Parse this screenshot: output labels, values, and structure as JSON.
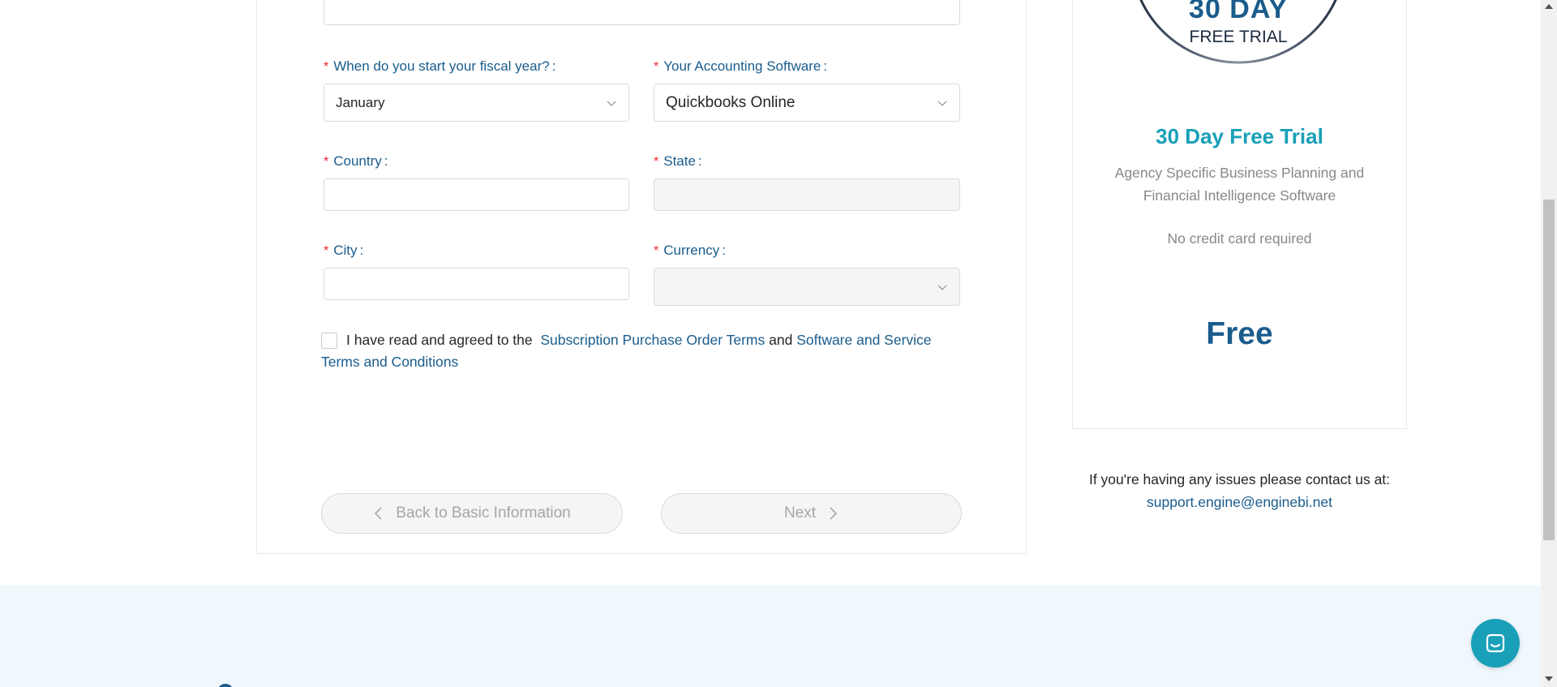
{
  "form": {
    "fiscal_year": {
      "label": "When do you start your fiscal year?",
      "required_mark": "*",
      "colon": ":",
      "value": "January"
    },
    "accounting_software": {
      "label": "Your Accounting Software",
      "required_mark": "*",
      "colon": ":",
      "value": "Quickbooks Online"
    },
    "country": {
      "label": "Country",
      "required_mark": "*",
      "colon": ":",
      "value": ""
    },
    "state": {
      "label": "State",
      "required_mark": "*",
      "colon": ":",
      "value": ""
    },
    "city": {
      "label": "City",
      "required_mark": "*",
      "colon": ":",
      "value": ""
    },
    "currency": {
      "label": "Currency",
      "required_mark": "*",
      "colon": ":",
      "value": ""
    },
    "agreement": {
      "checked": false,
      "prefix": "I have read and agreed to the",
      "link1": "Subscription Purchase Order Terms",
      "joiner": "and",
      "link2": "Software and Service Terms and Conditions"
    },
    "back_button": "Back to Basic Information",
    "next_button": "Next"
  },
  "trial_panel": {
    "badge_days": "30 DAY",
    "badge_label": "FREE TRIAL",
    "title": "30 Day Free Trial",
    "subtitle": "Agency Specific Business Planning and Financial Intelligence Software",
    "no_cc": "No credit card required",
    "price": "Free"
  },
  "contact": {
    "text": "If you're having any issues please contact us at:",
    "email": "support.engine@enginebi.net"
  },
  "colors": {
    "label_blue": "#1a5c8c",
    "teal": "#19a0b8",
    "required_red": "#f5222d",
    "footer_bg": "#f0f8fd"
  },
  "icons": {
    "chevron_down": "chevron-down-icon",
    "chevron_left": "chevron-left-icon",
    "chevron_right": "chevron-right-icon",
    "chat": "chat-icon"
  }
}
